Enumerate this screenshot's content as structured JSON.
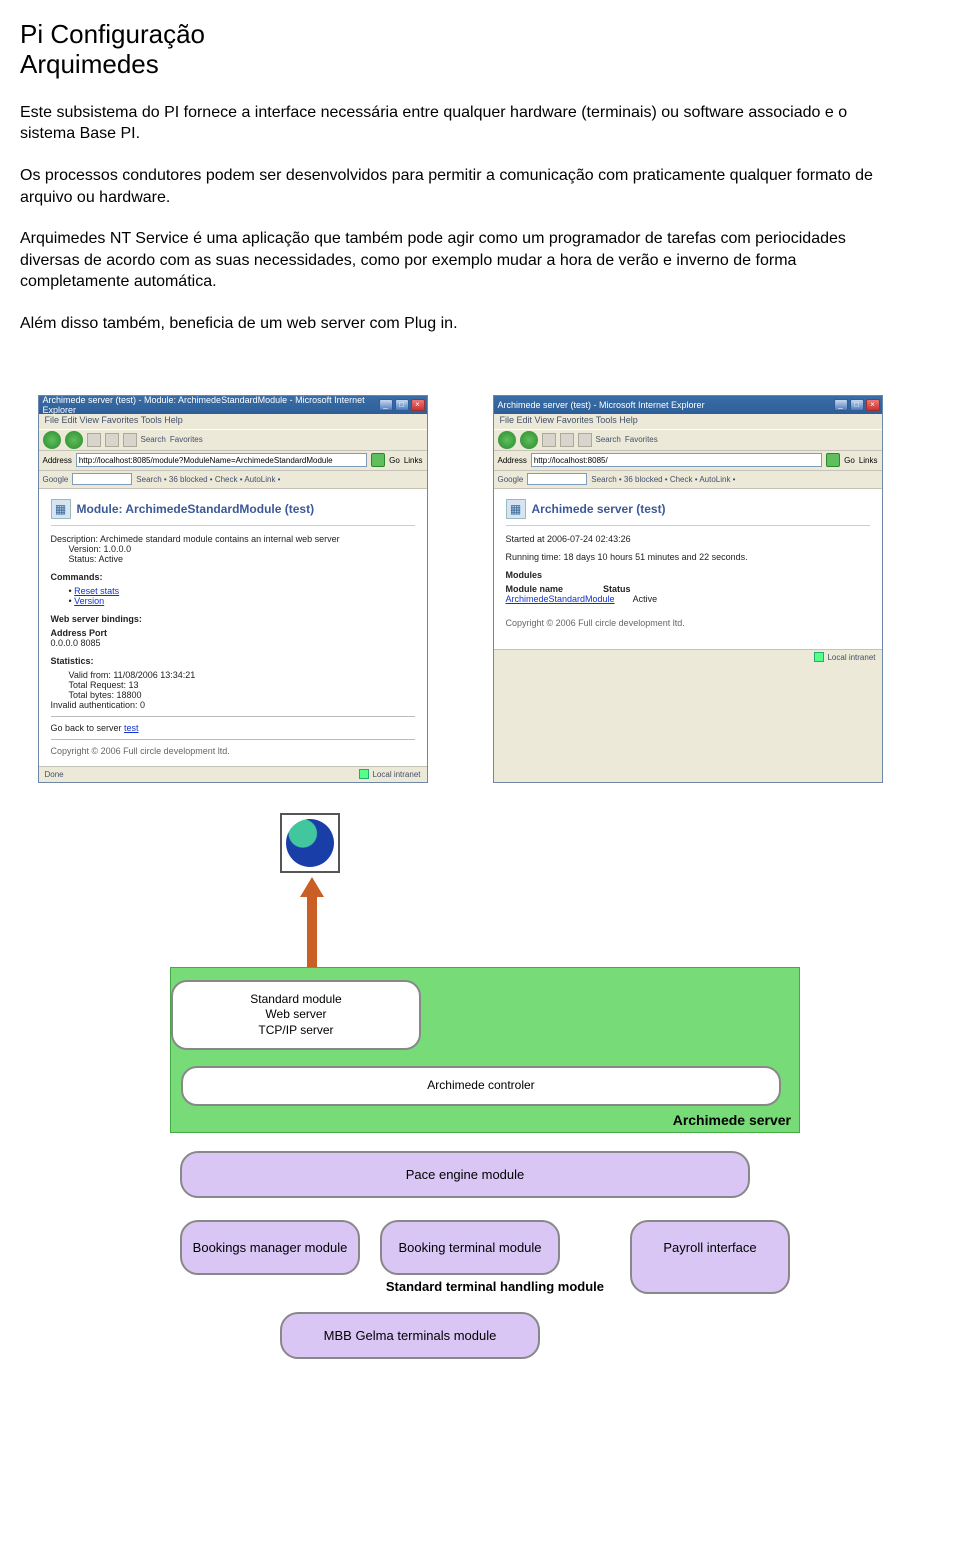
{
  "heading_line1": "Pi Configuração",
  "heading_line2": "Arquimedes",
  "para1": "Este subsistema do PI fornece a interface necessária entre qualquer hardware (terminais) ou software associado e o sistema Base PI.",
  "para2": "Os processos condutores podem ser desenvolvidos para permitir a comunicação com praticamente qualquer formato de arquivo ou hardware.",
  "para3": "Arquimedes NT Service é uma aplicação que também pode agir como um programador de tarefas com periocidades diversas de acordo com as suas necessidades, como por exemplo mudar a hora de verão e inverno de forma completamente automática.",
  "para4": "Além disso também, beneficia de um web server com Plug in.",
  "shot_left": {
    "title": "Archimede server (test) - Module: ArchimedeStandardModule - Microsoft Internet Explorer",
    "menu": "File   Edit   View   Favorites   Tools   Help",
    "toolbar": {
      "search": "Search",
      "favorites": "Favorites"
    },
    "addr_label": "Address",
    "addr_value": "http://localhost:8085/module?ModuleName=ArchimedeStandardModule",
    "go": "Go",
    "links": "Links",
    "google_label": "Google",
    "google_items": "Search  •  36 blocked  •  Check  •  AutoLink  •",
    "page_title": "Module: ArchimedeStandardModule (test)",
    "desc_label": "Description:",
    "desc_value": "Archimede standard module contains an internal web server",
    "version_label": "Version:",
    "version_value": "1.0.0.0",
    "status_label": "Status:",
    "status_value": "Active",
    "commands_hdr": "Commands:",
    "cmd1": "Reset stats",
    "cmd2": "Version",
    "bindings_hdr": "Web server bindings:",
    "addrport_hdr": "Address Port",
    "addrport_val": "0.0.0.0   8085",
    "stats_hdr": "Statistics:",
    "valid_from": "Valid from: 11/08/2006 13:34:21",
    "total_req": "Total Request: 13",
    "total_bytes": "Total bytes: 18800",
    "invalid_auth": "Invalid authentication: 0",
    "back_link_pre": "Go back to server ",
    "back_link": "test",
    "copyright": "Copyright © 2006 Full circle development ltd.",
    "status_done": "Done",
    "status_zone": "Local intranet"
  },
  "shot_right": {
    "title": "Archimede server (test) - Microsoft Internet Explorer",
    "menu": "File   Edit   View   Favorites   Tools   Help",
    "toolbar": {
      "search": "Search",
      "favorites": "Favorites"
    },
    "addr_label": "Address",
    "addr_value": "http://localhost:8085/",
    "go": "Go",
    "links": "Links",
    "google_label": "Google",
    "google_items": "Search  •  36 blocked  •  Check  •  AutoLink  •",
    "page_title": "Archimede server (test)",
    "started": "Started at 2006-07-24 02:43:26",
    "running": "Running time: 18 days 10 hours 51 minutes and 22 seconds.",
    "modules_hdr": "Modules",
    "mod_name_hdr": "Module name",
    "mod_status_hdr": "Status",
    "mod_name": "ArchimedeStandardModule",
    "mod_status": "Active",
    "copyright": "Copyright © 2006 Full circle development ltd.",
    "status_done": "",
    "status_zone": "Local intranet"
  },
  "diagram": {
    "std_module_l1": "Standard module",
    "std_module_l2": "Web server",
    "std_module_l3": "TCP/IP server",
    "controller": "Archimede controler",
    "server_label": "Archimede server",
    "pace": "Pace engine module",
    "bookings_mgr": "Bookings manager module",
    "booking_term": "Booking terminal module",
    "payroll": "Payroll interface",
    "std_handling": "Standard terminal handling module",
    "mbb": "MBB Gelma terminals module"
  }
}
